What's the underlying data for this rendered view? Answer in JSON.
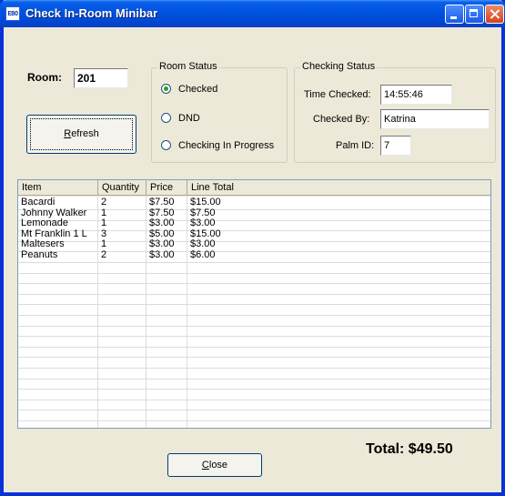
{
  "window": {
    "title": "Check In-Room Minibar",
    "app_icon_text": "EBO",
    "frame_color": "#0831d9",
    "face_color": "#ece9d8"
  },
  "room": {
    "label": "Room:",
    "value": "201"
  },
  "refresh_button": {
    "label": "Refresh",
    "accesskey": "R"
  },
  "room_status": {
    "title": "Room Status",
    "options": [
      {
        "label": "Checked",
        "selected": true
      },
      {
        "label": "DND",
        "selected": false
      },
      {
        "label": "Checking In Progress",
        "selected": false
      }
    ]
  },
  "checking_status": {
    "title": "Checking Status",
    "time_checked": {
      "label": "Time Checked:",
      "value": "14:55:46"
    },
    "checked_by": {
      "label": "Checked By:",
      "value": "Katrina"
    },
    "palm_id": {
      "label": "Palm ID:",
      "value": "7"
    }
  },
  "items_table": {
    "columns": [
      "Item",
      "Quantity",
      "Price",
      "Line Total"
    ],
    "rows": [
      [
        "Bacardi",
        "2",
        "$7.50",
        "$15.00"
      ],
      [
        "Johnny Walker",
        "1",
        "$7.50",
        "$7.50"
      ],
      [
        "Lemonade",
        "1",
        "$3.00",
        "$3.00"
      ],
      [
        "Mt Franklin 1 L",
        "3",
        "$5.00",
        "$15.00"
      ],
      [
        "Maltesers",
        "1",
        "$3.00",
        "$3.00"
      ],
      [
        "Peanuts",
        "2",
        "$3.00",
        "$6.00"
      ]
    ]
  },
  "total": {
    "text": "Total: $49.50"
  },
  "close_button": {
    "label": "Close",
    "accesskey": "C"
  }
}
